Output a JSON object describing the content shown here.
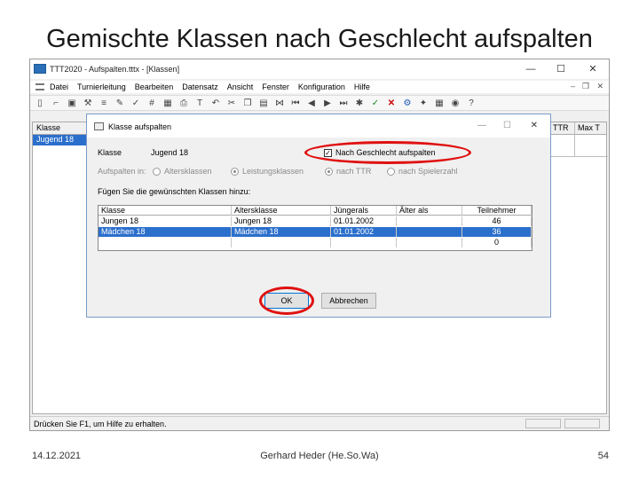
{
  "slide": {
    "title": "Gemischte Klassen nach Geschlecht aufspalten",
    "footer_date": "14.12.2021",
    "footer_author": "Gerhard Heder (He.So.Wa)",
    "footer_page": "54"
  },
  "app": {
    "window_title": "TTT2020 - Aufspalten.tttx - [Klassen]",
    "min_label": "—",
    "max_label": "☐",
    "close_label": "✕",
    "menu": [
      "Datei",
      "Turnierleitung",
      "Bearbeiten",
      "Datensatz",
      "Ansicht",
      "Fenster",
      "Konfiguration",
      "Hilfe"
    ],
    "mdi_controls": {
      "min": "–",
      "max": "❐",
      "close": "✕"
    },
    "grid": {
      "headers": {
        "klasse": "Klasse",
        "ttr": "TTR",
        "max": "Max T"
      },
      "selected_row": "Jugend 18"
    },
    "status_text": "Drücken Sie F1, um Hilfe zu erhalten."
  },
  "dialog": {
    "title": "Klasse aufspalten",
    "min_label": "—",
    "max_label": "☐",
    "close_label": "✕",
    "klasse_label": "Klasse",
    "klasse_value": "Jugend 18",
    "checkbox_label": "Nach Geschlecht aufspalten",
    "checkbox_checked": "✓",
    "aufspalten_label": "Aufspalten in:",
    "radio_options": [
      "Altersklassen",
      "Leistungsklassen",
      "nach TTR",
      "nach Spielerzahl"
    ],
    "list_label": "Fügen Sie die gewünschten Klassen hinzu:",
    "table": {
      "headers": [
        "Klasse",
        "Altersklasse",
        "Jüngerals",
        "Älter als",
        "Teilnehmer"
      ],
      "rows": [
        [
          "Jungen 18",
          "Jungen 18",
          "01.01.2002",
          "",
          "46"
        ],
        [
          "Mädchen 18",
          "Mädchen 18",
          "01.01.2002",
          "",
          "36"
        ],
        [
          "",
          "",
          "",
          "",
          "0"
        ]
      ]
    },
    "ok_label": "OK",
    "cancel_label": "Abbrechen"
  }
}
